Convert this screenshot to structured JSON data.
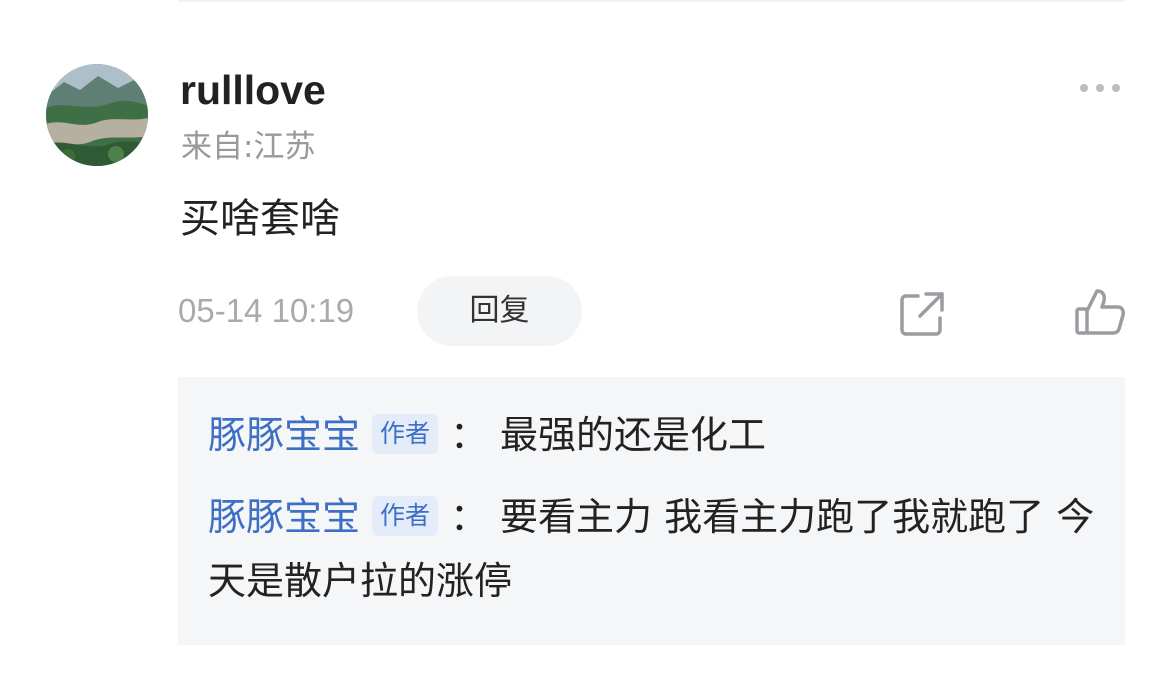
{
  "comment": {
    "username": "rulllove",
    "location": "来自:江苏",
    "text": "买啥套啥",
    "timestamp": "05-14 10:19",
    "reply_label": "回复"
  },
  "icons": {
    "more": "more-dots-icon",
    "share": "share-external-icon",
    "like": "thumbs-up-icon",
    "avatar": "landscape-avatar"
  },
  "replies": [
    {
      "author": "豚豚宝宝",
      "badge": "作者",
      "separator": "：",
      "text": "最强的还是化工"
    },
    {
      "author": "豚豚宝宝",
      "badge": "作者",
      "separator": "：",
      "text": "要看主力 我看主力跑了我就跑了 今天是散户拉的涨停"
    }
  ],
  "colors": {
    "author_link": "#3e6fc6",
    "muted_text": "#999999",
    "reply_background": "#f5f6f8"
  }
}
